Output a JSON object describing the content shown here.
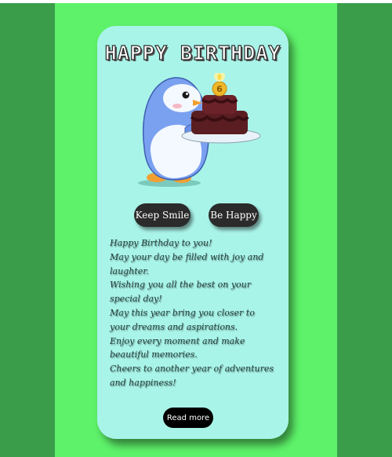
{
  "card": {
    "title": "HAPPY BIRTHDAY",
    "illustration": "penguin-with-birthday-cake",
    "candle_number": "6"
  },
  "buttons": {
    "keep_smile": "Keep Smile",
    "be_happy": "Be Happy",
    "read_more": "Read more"
  },
  "message": [
    "Happy Birthday to you!",
    "May your day be filled with joy and laughter.",
    "Wishing you all the best on your special day!",
    "May this year bring you closer to your dreams and aspirations.",
    "Enjoy every moment and make beautiful memories.",
    "Cheers to another year of adventures and happiness!"
  ],
  "colors": {
    "stage": "#5ef26a",
    "side_panels": "#3a9d4a",
    "card": "#a9f4e9",
    "button": "#2b2b2b",
    "read_more": "#000000"
  }
}
